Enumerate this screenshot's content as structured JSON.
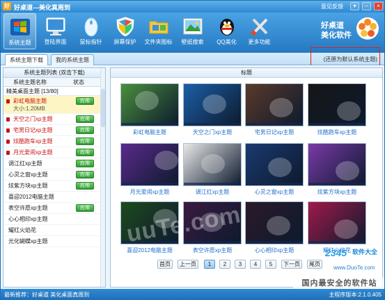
{
  "app": {
    "title": "好桌道—美化真周到",
    "feedback": "意见反馈",
    "logo_line1": "好桌道",
    "logo_line2": "美化软件"
  },
  "window_controls": {
    "menu": "▾",
    "minimize": "–",
    "close": "×"
  },
  "toolbar": {
    "items": [
      {
        "label": "系统主题",
        "icon": "windows-theme-icon",
        "active": true
      },
      {
        "label": "登陆界面",
        "icon": "monitor-icon",
        "active": false
      },
      {
        "label": "鼠标指针",
        "icon": "mouse-icon",
        "active": false
      },
      {
        "label": "屏幕保护",
        "icon": "shield-icon",
        "active": false
      },
      {
        "label": "文件夹图标",
        "icon": "folder-icon",
        "active": false
      },
      {
        "label": "壁纸搜索",
        "icon": "picture-icon",
        "active": false
      },
      {
        "label": "QQ美化",
        "icon": "qq-penguin-icon",
        "active": false
      },
      {
        "label": "更多功能",
        "icon": "tools-icon",
        "active": false
      }
    ]
  },
  "tabs": [
    {
      "label": "系统主题下载",
      "active": true
    },
    {
      "label": "我的系统主题",
      "active": false
    }
  ],
  "restore_default": "(还原为默认系统主题)",
  "left_panel": {
    "header": "系统主题列表 (双击下载)",
    "col_name": "系统主题名称",
    "col_status": "状态",
    "group": "精美桌面主题  [13/80]",
    "apply_label": "应用",
    "items": [
      {
        "name": "彩虹电脑主题",
        "red": true,
        "selected": true,
        "size": "大小:1.20MB",
        "apply": true
      },
      {
        "name": "天空之门xp主题",
        "red": true,
        "apply": true
      },
      {
        "name": "宅男日记xp主题",
        "red": true,
        "apply": true
      },
      {
        "name": "炫酷跑车xp主题",
        "red": true,
        "apply": true
      },
      {
        "name": "月光爱闹xp主题",
        "red": true,
        "apply": true
      },
      {
        "name": "调江红xp主题",
        "red": false,
        "apply": true
      },
      {
        "name": "心灵之窗xp主题",
        "red": false,
        "apply": true
      },
      {
        "name": "炫紫方块xp主题",
        "red": false,
        "apply": true
      },
      {
        "name": "喜迎2012电脑主题",
        "red": false,
        "apply": false
      },
      {
        "name": "表空许愿xp主题",
        "red": false,
        "apply": true
      },
      {
        "name": "心心相印xp主题",
        "red": false,
        "apply": false
      },
      {
        "name": "耀红火焰花",
        "red": false,
        "apply": false
      },
      {
        "name": "光化蝴蝶xp主题",
        "red": false,
        "apply": false
      }
    ]
  },
  "right_panel": {
    "header": "标题",
    "thumbs": [
      {
        "caption": "彩虹电脑主题"
      },
      {
        "caption": "天空之门xp主题"
      },
      {
        "caption": "宅男日记xp主题"
      },
      {
        "caption": "炫酷跑车xp主题"
      },
      {
        "caption": "月光爱闹xp主题"
      },
      {
        "caption": "调江红xp主题"
      },
      {
        "caption": "心灵之窗xp主题"
      },
      {
        "caption": "炫紫方块xp主题"
      },
      {
        "caption": "喜迎2012电脑主题"
      },
      {
        "caption": "表空许愿xp主题"
      },
      {
        "caption": "心心相印xp主题"
      },
      {
        "caption": "耀红火焰花"
      }
    ],
    "colors": [
      "#4a8f3c",
      "#1b5fa8",
      "#5a3a2a",
      "#161616",
      "#5a2a8c",
      "#e8e8e8",
      "#1a3a70",
      "#7a3aa8",
      "#1e4a1e",
      "#3a1a40",
      "#2a1a2a",
      "#a01a4a"
    ]
  },
  "pager": {
    "first": "首页",
    "prev": "上一页",
    "pages": [
      "1",
      "2",
      "3",
      "4",
      "5"
    ],
    "current": "1",
    "next": "下一页",
    "last": "尾页"
  },
  "status": {
    "recommend": "最新推荐：好桌道 美化桌面真周到",
    "version": "主程序版本:2.1.0.405"
  },
  "watermark": {
    "overlay": "uuTe.com",
    "logo": "2345",
    "brand": "软件大全",
    "url": "www.DuoTe.com",
    "banner": "国内最安全的软件站"
  }
}
